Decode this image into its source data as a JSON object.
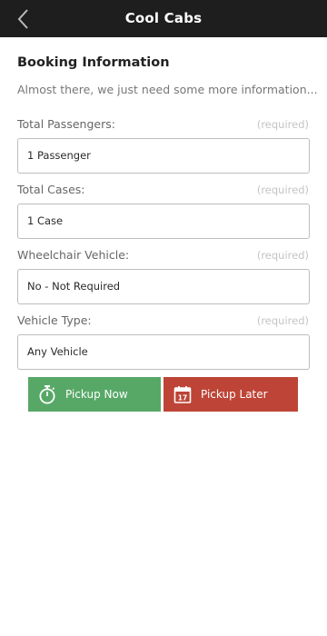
{
  "header": {
    "title": "Cool Cabs",
    "back_icon": "chevron-left-icon"
  },
  "booking": {
    "title": "Booking Information",
    "intro": "Almost there, we just need some more information...",
    "required_text": "(required)",
    "fields": [
      {
        "label": "Total Passengers:",
        "value": "1 Passenger"
      },
      {
        "label": "Total Cases:",
        "value": "1 Case"
      },
      {
        "label": "Wheelchair Vehicle:",
        "value": "No - Not Required"
      },
      {
        "label": "Vehicle Type:",
        "value": "Any Vehicle"
      }
    ]
  },
  "actions": {
    "pickup_now": {
      "label": "Pickup Now",
      "icon": "stopwatch-icon",
      "color": "#57a867"
    },
    "pickup_later": {
      "label": "Pickup Later",
      "icon": "calendar-icon",
      "calendar_day": "17",
      "color": "#bd4436"
    }
  }
}
